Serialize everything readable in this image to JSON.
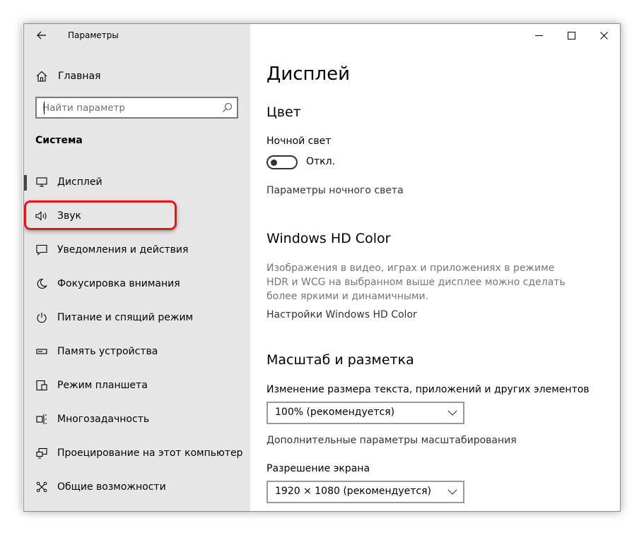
{
  "window": {
    "title": "Параметры",
    "controls": {
      "minimize": "—",
      "maximize": "☐",
      "close": "✕"
    }
  },
  "sidebar": {
    "home_label": "Главная",
    "search": {
      "placeholder": "Найти параметр",
      "value": ""
    },
    "section_title": "Система",
    "items": [
      {
        "label": "Дисплей",
        "icon": "monitor-icon",
        "active": true
      },
      {
        "label": "Звук",
        "icon": "speaker-icon",
        "highlighted": true
      },
      {
        "label": "Уведомления и действия",
        "icon": "notification-icon"
      },
      {
        "label": "Фокусировка внимания",
        "icon": "moon-icon"
      },
      {
        "label": "Питание и спящий режим",
        "icon": "power-icon"
      },
      {
        "label": "Память устройства",
        "icon": "storage-icon"
      },
      {
        "label": "Режим планшета",
        "icon": "tablet-icon"
      },
      {
        "label": "Многозадачность",
        "icon": "multitasking-icon"
      },
      {
        "label": "Проецирование на этот компьютер",
        "icon": "projection-icon"
      },
      {
        "label": "Общие возможности",
        "icon": "shared-experiences-icon"
      }
    ]
  },
  "main": {
    "page_title": "Дисплей",
    "color": {
      "heading": "Цвет",
      "night_light_label": "Ночной свет",
      "night_light_state": "Откл.",
      "night_light_on": false,
      "night_light_settings_link": "Параметры ночного света"
    },
    "hd_color": {
      "heading": "Windows HD Color",
      "description": "Изображения в видео, играх и приложениях в режиме HDR и WCG на выбранном выше дисплее можно сделать более яркими и динамичными.",
      "settings_link": "Настройки Windows HD Color"
    },
    "scale": {
      "heading": "Масштаб и разметка",
      "size_label": "Изменение размера текста, приложений и других элементов",
      "size_value": "100% (рекомендуется)",
      "advanced_link": "Дополнительные параметры масштабирования",
      "resolution_label": "Разрешение экрана",
      "resolution_value": "1920 × 1080 (рекомендуется)"
    }
  },
  "colors": {
    "sidebar_bg": "#e6e6e6",
    "highlight_red": "#e01818",
    "link_text": "#333333",
    "muted_text": "#767676"
  }
}
